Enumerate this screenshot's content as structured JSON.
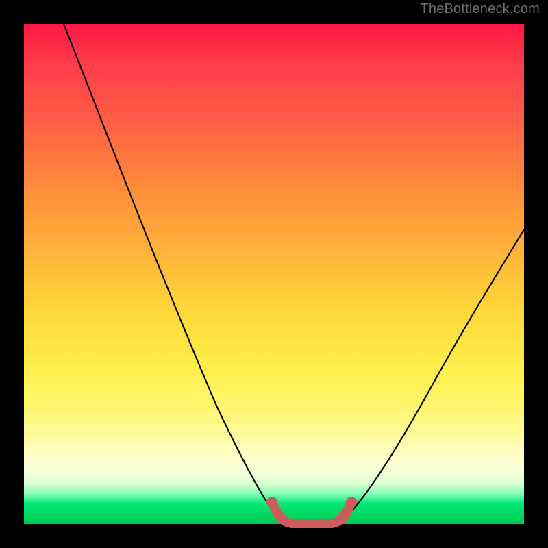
{
  "watermark": "TheBottleneck.com",
  "chart_data": {
    "type": "line",
    "title": "",
    "xlabel": "",
    "ylabel": "",
    "xlim": [
      0,
      100
    ],
    "ylim": [
      0,
      100
    ],
    "series": [
      {
        "name": "bottleneck-curve",
        "x": [
          8,
          15,
          22,
          30,
          38,
          46,
          49,
          52,
          55,
          60,
          62,
          66,
          72,
          80,
          90,
          100
        ],
        "y": [
          100,
          82,
          65,
          48,
          32,
          14,
          6,
          1,
          0,
          0,
          1,
          6,
          14,
          28,
          46,
          62
        ],
        "color": "#000000"
      }
    ],
    "highlight": {
      "name": "optimal-zone",
      "x": [
        49,
        52,
        55,
        58,
        60,
        62
      ],
      "y": [
        6,
        1,
        0,
        0,
        1,
        6
      ],
      "color": "#cd5c5c"
    },
    "gradient_bands": [
      {
        "pct": 0,
        "color": "#ff1744"
      },
      {
        "pct": 32,
        "color": "#ff8a3a"
      },
      {
        "pct": 58,
        "color": "#ffd93a"
      },
      {
        "pct": 87,
        "color": "#ffffd0"
      },
      {
        "pct": 96,
        "color": "#00e676"
      },
      {
        "pct": 100,
        "color": "#00c853"
      }
    ]
  }
}
